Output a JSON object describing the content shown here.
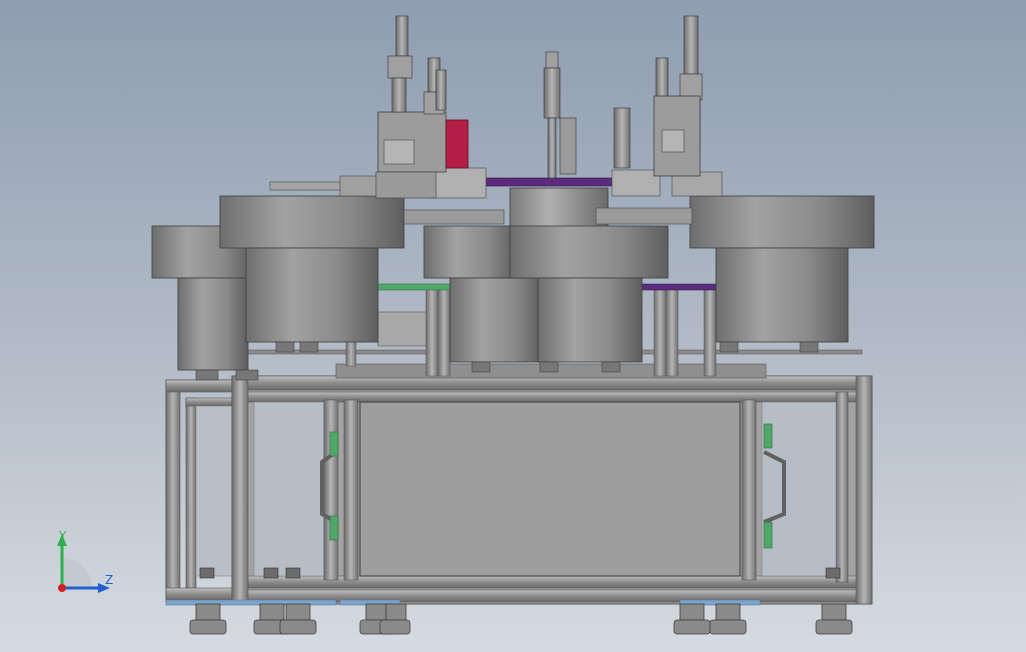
{
  "viewport": {
    "background_top": "#8e9db0",
    "background_bottom": "#d6dbe1"
  },
  "model": {
    "body_color": "#8f8f8f",
    "frame_color": "#9a9a9a",
    "accent_red": "#b51e47",
    "accent_purple": "#5b2c7e",
    "accent_green": "#4fa868",
    "foot_blue": "#7fa4c9"
  },
  "triad": {
    "y_label": "Y",
    "z_label": "Z",
    "y_color": "#2bb24c",
    "z_color": "#2060d0",
    "origin_color": "#d02020",
    "icons": [
      "axis-triad-icon"
    ]
  }
}
